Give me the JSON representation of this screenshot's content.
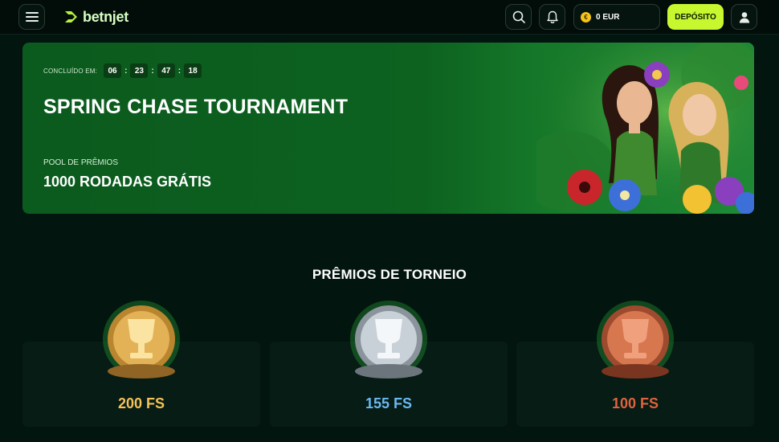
{
  "header": {
    "logo_text": "betnjet",
    "wallet_currency_symbol": "€",
    "wallet_balance": "0 EUR",
    "deposit_label": "DEPÓSITO",
    "icons": [
      "menu-icon",
      "search-icon",
      "bell-icon",
      "user-icon"
    ]
  },
  "hero": {
    "countdown_label": "CONCLUÍDO EM:",
    "countdown": [
      "06",
      "23",
      "47",
      "18"
    ],
    "title": "SPRING CHASE TOURNAMENT",
    "pool_label": "POOL DE PRÊMIOS",
    "pool_value": "1000 RODADAS GRÁTIS"
  },
  "prizes": {
    "title": "PRÊMIOS DE TORNEIO",
    "items": [
      {
        "value": "200 FS",
        "medal": "gold",
        "color": "#f5c15a"
      },
      {
        "value": "155 FS",
        "medal": "silver",
        "color": "#6bb8f2"
      },
      {
        "value": "100 FS",
        "medal": "bronze",
        "color": "#e0623e"
      }
    ]
  },
  "colors": {
    "accent": "#c7f72f",
    "background": "#03150f",
    "hero_green": "#0d6220"
  }
}
